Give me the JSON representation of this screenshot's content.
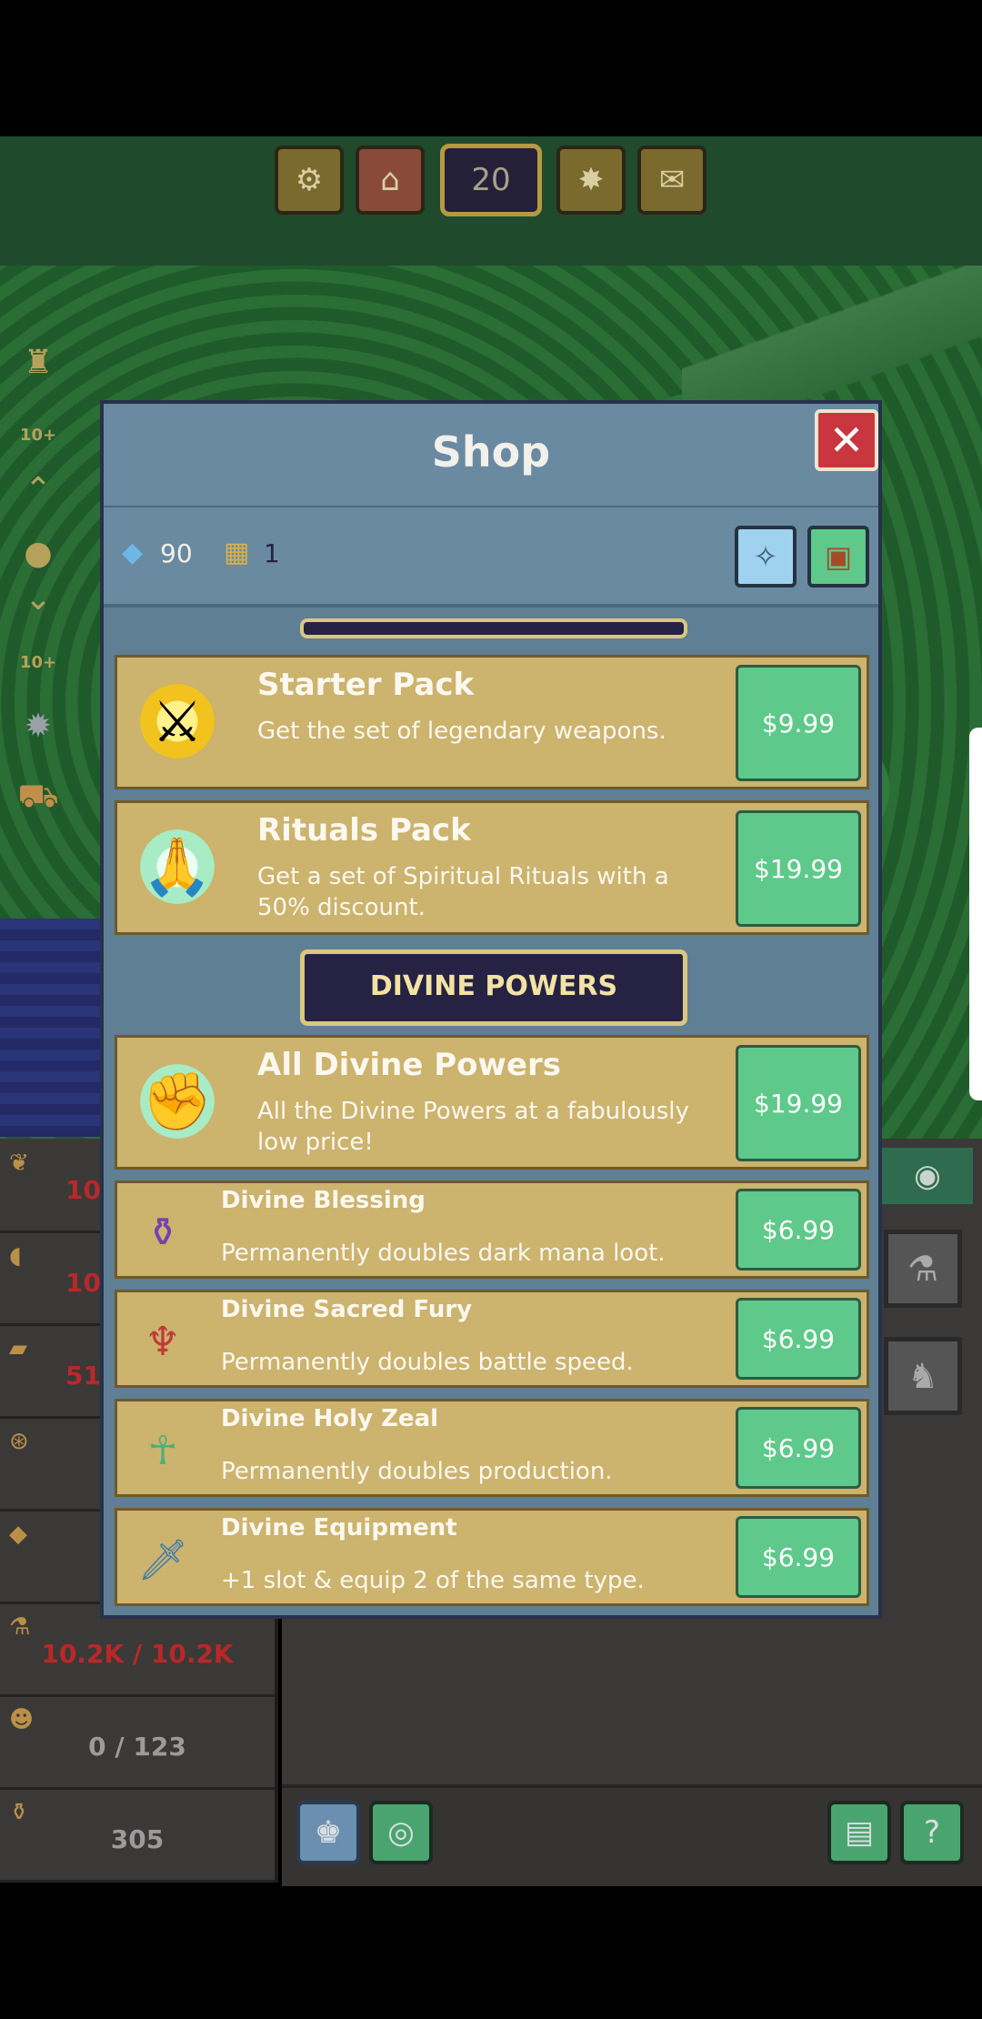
{
  "hud": {
    "level": "20",
    "settings_icon": "gear-icon",
    "market_icon": "market-stall-icon",
    "rank_icon": "star-badge-icon",
    "chat_icon": "speech-bubble-icon"
  },
  "side": {
    "badge_top": "10+",
    "badge_bottom": "10+"
  },
  "stats": {
    "rows": [
      {
        "icon": "wheat-icon",
        "value": "10",
        "color": "#b82828"
      },
      {
        "icon": "wood-icon",
        "value": "10",
        "color": "#b82828"
      },
      {
        "icon": "iron-icon",
        "value": "51.",
        "color": "#b82828"
      },
      {
        "icon": "pouch-icon",
        "value": "",
        "color": "#b82828"
      },
      {
        "icon": "gem-icon",
        "value": "",
        "color": "#b82828"
      },
      {
        "icon": "potion-icon",
        "value": "10.2K / 10.2K",
        "color": "#b82828"
      },
      {
        "icon": "worker-icon",
        "value": "0 / 123",
        "color": "#9c9a9a"
      },
      {
        "icon": "mana-icon",
        "value": "305",
        "color": "#9c9a9a"
      }
    ]
  },
  "shop": {
    "title": "Shop",
    "close_glyph": "✕",
    "currency": {
      "crystals": "90",
      "tickets": "1"
    },
    "section_divine": "DIVINE POWERS",
    "items_top": [
      {
        "name": "Starter Pack",
        "desc": "Get the set of legendary weapons.",
        "price": "$9.99",
        "icon": "hero-sword-icon"
      },
      {
        "name": "Rituals Pack",
        "desc": "Get a set of Spiritual Rituals with a 50% discount.",
        "price": "$19.99",
        "icon": "praying-hands-50x-icon"
      }
    ],
    "item_all_divine": {
      "name": "All Divine Powers",
      "desc": "All the Divine Powers at a fabulously low price!",
      "price": "$19.99",
      "icon": "raised-fist-icon"
    },
    "items_divine": [
      {
        "name": "Divine Blessing",
        "desc": "Permanently doubles dark mana loot.",
        "price": "$6.99",
        "icon": "mana-potion-2x-icon"
      },
      {
        "name": "Divine Sacred Fury",
        "desc": "Permanently doubles battle speed.",
        "price": "$6.99",
        "icon": "winged-demon-2x-icon"
      },
      {
        "name": "Divine Holy Zeal",
        "desc": "Permanently doubles production.",
        "price": "$6.99",
        "icon": "angel-2x-icon"
      },
      {
        "name": "Divine Equipment",
        "desc": "+1 slot & equip 2 of the same type.",
        "price": "$6.99",
        "icon": "sword-icon"
      }
    ]
  },
  "colors": {
    "price_button": "#5ec98a",
    "item_card": "#ccb36e",
    "close_button": "#c9363f"
  }
}
